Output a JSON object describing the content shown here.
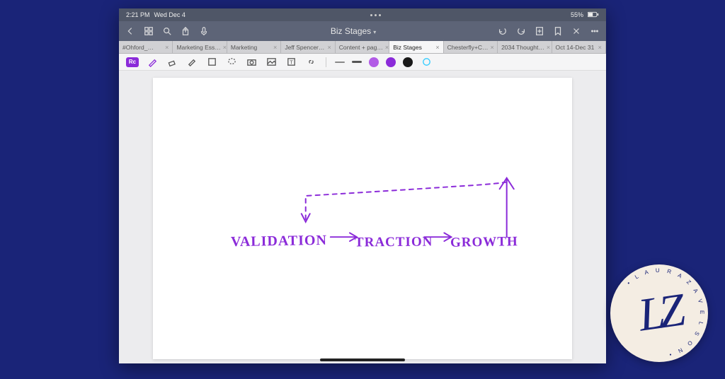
{
  "status": {
    "time": "2:21 PM",
    "date": "Wed Dec 4",
    "battery": "55%"
  },
  "app": {
    "title": "Biz Stages"
  },
  "tabs": [
    {
      "label": "#Ohford_…"
    },
    {
      "label": "Marketing Ess…"
    },
    {
      "label": "Marketing"
    },
    {
      "label": "Jeff Spencer…"
    },
    {
      "label": "Content + pag…"
    },
    {
      "label": "Biz Stages",
      "active": true
    },
    {
      "label": "Chesterfly+C…"
    },
    {
      "label": "2034 Thought…"
    },
    {
      "label": "Oct 14-Dec 31"
    }
  ],
  "tool_mode": "Rc",
  "handwriting": {
    "stage1": "VALIDATION",
    "stage2": "TRACTION",
    "stage3": "GROWTH"
  },
  "palette": {
    "purple_light": "#b25be6",
    "purple": "#8b2bd9",
    "black": "#1a1a1a"
  },
  "logo": {
    "initials": "LZ",
    "ring_text": "LAURA ZAVELSON"
  }
}
